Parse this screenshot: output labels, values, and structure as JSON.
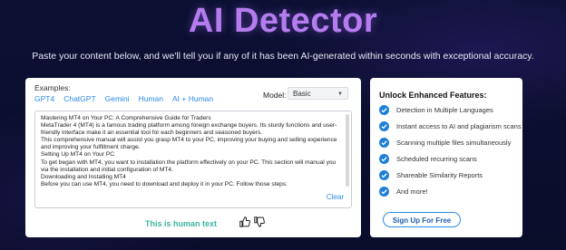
{
  "header": {
    "title": "AI Detector",
    "subtitle": "Paste your content below, and we'll tell you if any of it has been AI-generated within seconds with exceptional accuracy."
  },
  "detector": {
    "examples_label": "Examples:",
    "example_links": [
      "GPT4",
      "ChatGPT",
      "Gemini",
      "Human",
      "AI + Human"
    ],
    "model_label": "Model:",
    "model_value": "Basic",
    "text_lines": [
      "Mastering MT4 on Your PC: A Comprehensive Guide for Traders",
      "MetaTrader 4 (MT4) is a famous trading platform among foreign exchange buyers. Its sturdy functions and user-friendly interface make it an essential tool for each beginners and seasoned buyers.",
      "This comprehensive manual will assist you grasp MT4 to your PC, improving your buying and selling experience and improving your fulfillment charge.",
      "Setting Up MT4 on Your PC",
      "To get began with MT4, you want to installation the platform effectively on your PC. This section will manual you via the installation and initial configuration of MT4.",
      "Downloading and Installing MT4",
      "Before you can use MT4, you need to download and deploy it in your PC. Follow those steps:"
    ],
    "clear_label": "Clear",
    "result_text": "This is human text"
  },
  "features": {
    "title": "Unlock Enhanced Features:",
    "items": [
      "Detection in Multiple Languages",
      "Instant access to AI and plagiarism scans",
      "Scanning multiple files simultaneously",
      "Scheduled recurring scans",
      "Shareable Similarity Reports",
      "And more!"
    ],
    "signup_label": "Sign Up For Free"
  },
  "colors": {
    "title": "#b57cf0",
    "link": "#2b8be6",
    "result": "#3cb4a0",
    "check": "#1e7fd6"
  }
}
